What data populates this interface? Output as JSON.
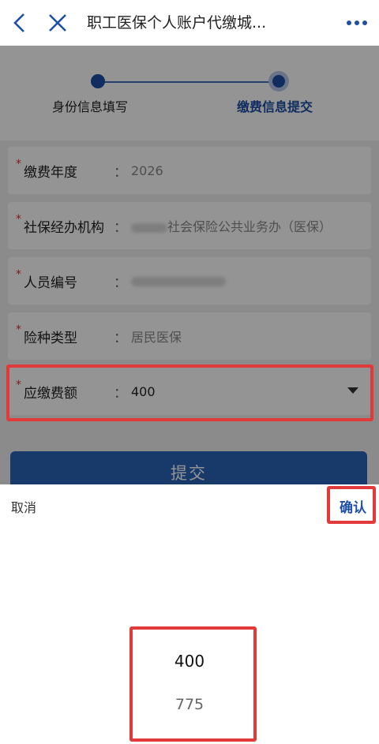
{
  "header": {
    "title": "职工医保个人账户代缴城...",
    "back_icon": "chevron-left-icon",
    "close_icon": "close-icon",
    "more_icon": "more-dots-icon",
    "icon_color": "#1e4fa6"
  },
  "steps": [
    {
      "label": "身份信息填写"
    },
    {
      "label": "缴费信息提交"
    }
  ],
  "form": {
    "rows": [
      {
        "label": "缴费年度",
        "value": "2026"
      },
      {
        "label": "社保经办机构",
        "value": "社会保险公共业务办（医保）"
      },
      {
        "label": "人员编号",
        "value": ""
      },
      {
        "label": "险种类型",
        "value": "居民医保"
      },
      {
        "label": "应缴费额",
        "value": "400"
      }
    ],
    "colon": "："
  },
  "submit_label": "提交",
  "picker": {
    "cancel_label": "取消",
    "confirm_label": "确认",
    "options": [
      "400",
      "775"
    ],
    "selected_index": 0
  },
  "colors": {
    "accent": "#1e4fa6",
    "highlight": "#e23a3a",
    "required": "#e03030"
  }
}
